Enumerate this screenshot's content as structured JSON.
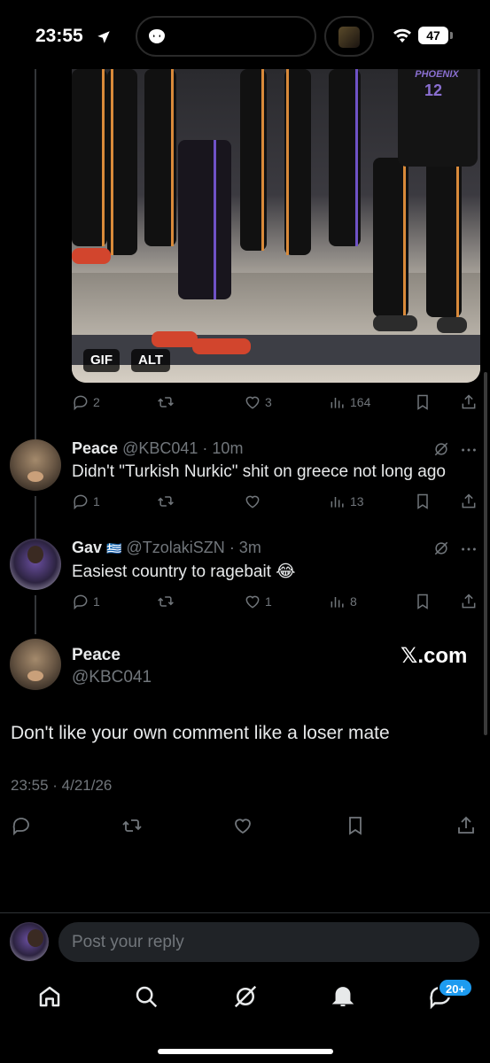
{
  "status_bar": {
    "time": "23:55",
    "battery": "47"
  },
  "media": {
    "badges": [
      "GIF",
      "ALT"
    ],
    "jersey_text": "PHOENIX",
    "jersey_number": "12"
  },
  "tweet1_actions": {
    "replies": "2",
    "reposts": "",
    "likes": "3",
    "views": "164"
  },
  "tweets": [
    {
      "name": "Peace",
      "handle": "@KBC041",
      "time": "· 10m",
      "text": "Didn't \"Turkish Nurkic\" shit on greece not long ago",
      "replies": "1",
      "reposts": "",
      "likes": "",
      "views": "13"
    },
    {
      "name": "Gav",
      "flag": "🇬🇷",
      "handle": "@TzolakiSZN",
      "time": "· 3m",
      "text": "Easiest country to ragebait 😂",
      "replies": "1",
      "reposts": "",
      "likes": "1",
      "views": "8"
    }
  ],
  "main_tweet": {
    "name": "Peace",
    "handle": "@KBC041",
    "watermark": "𝕏.com",
    "text": "Don't like your own comment like a loser mate",
    "timestamp": "23:55 · 4/21/26"
  },
  "reply": {
    "placeholder": "Post your reply"
  },
  "nav": {
    "messages_badge": "20+"
  }
}
